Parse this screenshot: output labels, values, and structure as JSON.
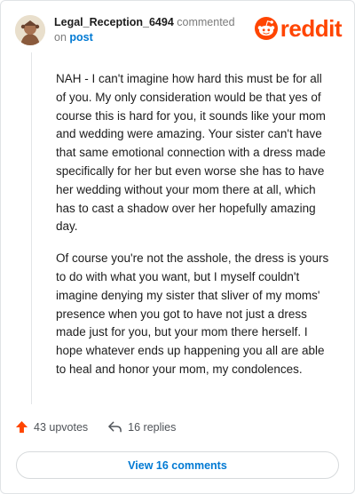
{
  "comment": {
    "username": "Legal_Reception_6494",
    "commented_label": "commented",
    "on_label": "on",
    "post_label": "post",
    "paragraphs": [
      "NAH - I can't imagine how hard this must be for all of you. My only consideration would be that yes of course this is hard for you, it sounds like your mom and wedding were amazing. Your sister can't have that same emotional connection with a dress made specifically for her but even worse she has to have her wedding without your mom there at all, which has to cast a shadow over her hopefully amazing day.",
      "Of course you're not the asshole, the dress is yours to do with what you want, but I myself couldn't imagine denying my sister that sliver of my moms' presence when you got to have not just a dress made just for you, but your mom there herself. I hope whatever ends up happening you all are able to heal and honor your mom, my condolences."
    ]
  },
  "logo": {
    "wordmark": "reddit",
    "icon": "reddit-snoo-icon"
  },
  "actions": {
    "upvotes": "43 upvotes",
    "upvote_icon": "upvote-arrow-icon",
    "replies": "16 replies",
    "reply_icon": "reply-arrow-icon"
  },
  "view_button": {
    "label": "View 16 comments"
  },
  "colors": {
    "brand": "#ff4500",
    "link": "#0079d3",
    "text": "#1c1c1c",
    "muted": "#7c7c7c"
  }
}
